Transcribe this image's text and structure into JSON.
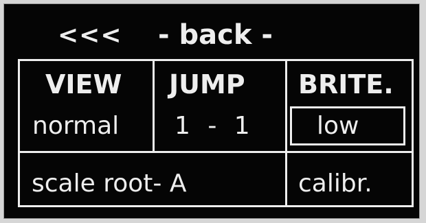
{
  "header": {
    "back_arrows": "<<<",
    "back_label": "- back -"
  },
  "cells": {
    "view": {
      "label": "VIEW",
      "value": "normal"
    },
    "jump": {
      "label": "JUMP",
      "value": "1 - 1"
    },
    "brite": {
      "label": "BRITE.",
      "value": "low",
      "selected": true
    },
    "scale_root": {
      "label": "scale root-  A"
    },
    "calibrate": {
      "label": "calibr."
    }
  },
  "colors": {
    "screen_bg": "#050505",
    "foreground": "#eeeeee",
    "bezel": "#d6d6d6"
  }
}
